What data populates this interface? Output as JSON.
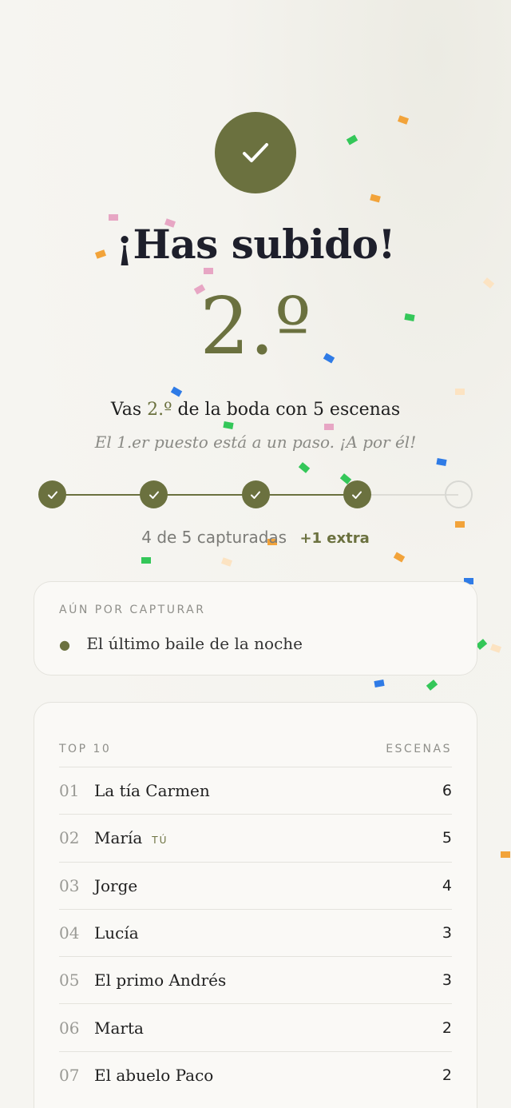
{
  "header": {
    "title": "¡Has subido!",
    "rank": "2.º"
  },
  "summary": {
    "prefix": "Vas",
    "rank": "2.º",
    "suffix": "de la boda con 5 escenas",
    "motto": "El 1.er puesto está a un paso. ¡A por él!"
  },
  "progress": {
    "captured": 4,
    "total": 5,
    "label": "4 de 5 capturadas",
    "extra": "+1 extra"
  },
  "pending": {
    "label": "AÚN POR CAPTURAR",
    "items": [
      "El último baile de la noche"
    ]
  },
  "leaderboard": {
    "title": "TOP 10",
    "column": "ESCENAS",
    "you_badge": "TÚ",
    "rows": [
      {
        "pos": "01",
        "name": "La tía Carmen",
        "scenes": "6",
        "you": false
      },
      {
        "pos": "02",
        "name": "María",
        "scenes": "5",
        "you": true
      },
      {
        "pos": "03",
        "name": "Jorge",
        "scenes": "4",
        "you": false
      },
      {
        "pos": "04",
        "name": "Lucía",
        "scenes": "3",
        "you": false
      },
      {
        "pos": "05",
        "name": "El primo Andrés",
        "scenes": "3",
        "you": false
      },
      {
        "pos": "06",
        "name": "Marta",
        "scenes": "2",
        "you": false
      },
      {
        "pos": "07",
        "name": "El abuelo Paco",
        "scenes": "2",
        "you": false
      }
    ]
  },
  "colors": {
    "accent": "#6b713f",
    "confetti": [
      "#34c759",
      "#f2a33a",
      "#2f7be6",
      "#e7a6c4",
      "#fce3c2"
    ]
  },
  "icons": {
    "success": "check-icon",
    "step_done": "check-icon",
    "bullet": "bullet-dot-icon"
  }
}
